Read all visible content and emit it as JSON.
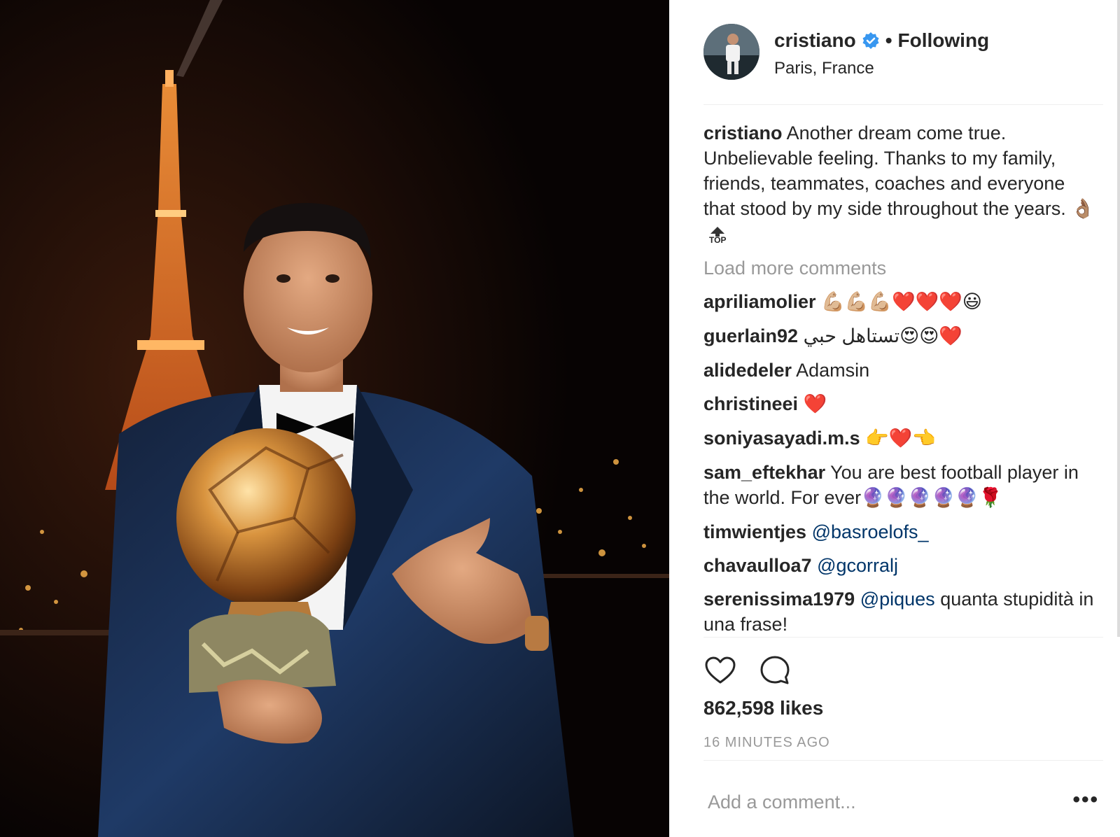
{
  "post": {
    "username": "cristiano",
    "follow_label": "Following",
    "location": "Paris, France",
    "caption": {
      "user": "cristiano",
      "text": "Another dream come true. Unbelievable feeling. Thanks to my family, friends, teammates, coaches and everyone that stood by my side throughout the years.",
      "emoji": "👌🏽",
      "top_label": "TOP"
    },
    "load_more_label": "Load more comments",
    "comments": [
      {
        "user": "apriliamolier",
        "text": "",
        "emoji": "💪🏼💪🏼💪🏼❤️❤️❤️😃"
      },
      {
        "user": "guerlain92",
        "text": "تستاهل حبي",
        "emoji": "😍😍❤️"
      },
      {
        "user": "alidedeler",
        "text": "Adamsin",
        "emoji": ""
      },
      {
        "user": "christineei",
        "text": "",
        "emoji": "❤️"
      },
      {
        "user": "soniyasayadi.m.s",
        "text": "",
        "emoji": "👉❤️👈"
      },
      {
        "user": "sam_eftekhar",
        "text": "You are best football player in the world. For ever",
        "emoji": "🔮🔮🔮🔮🔮🌹"
      },
      {
        "user": "timwientjes",
        "mention": "@basroelofs_",
        "text": ""
      },
      {
        "user": "chavaulloa7",
        "mention": "@gcorralj",
        "text": ""
      },
      {
        "user": "serenissima1979",
        "mention": "@piques",
        "text": "quanta stupidità in una frase!"
      }
    ],
    "likes": "862,598 likes",
    "timestamp": "16 MINUTES AGO",
    "add_comment_placeholder": "Add a comment...",
    "more_label": "•••"
  },
  "icons": [
    "verified-badge-icon",
    "heart-icon",
    "comment-icon",
    "top-arrow-icon",
    "more-options-icon"
  ],
  "colors": {
    "mention": "#003569",
    "verified": "#3897f0",
    "muted": "#999999"
  }
}
